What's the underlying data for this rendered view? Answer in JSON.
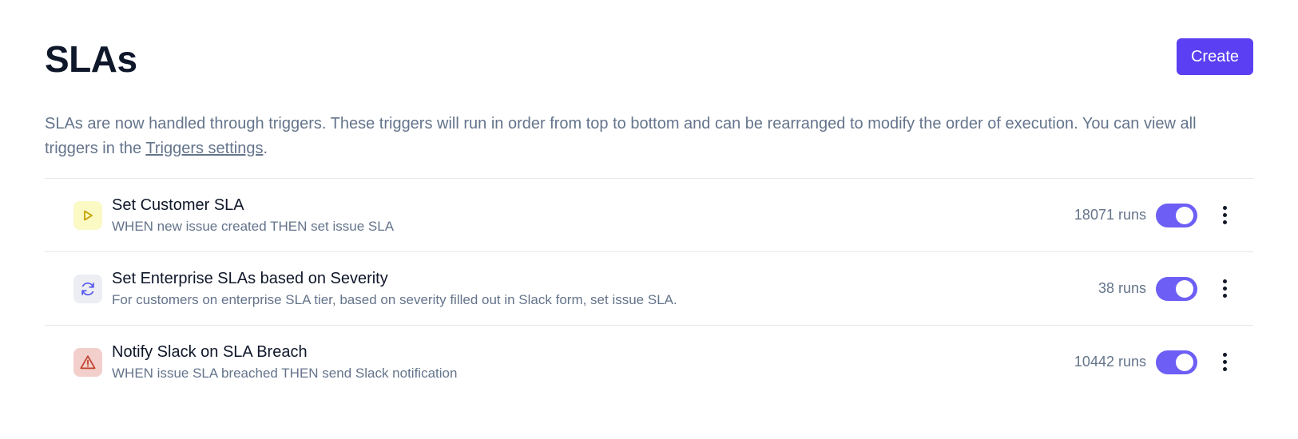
{
  "header": {
    "title": "SLAs",
    "create_label": "Create"
  },
  "description": {
    "text_before": "SLAs are now handled through triggers. These triggers will run in order from top to bottom and can be rearranged to modify the order of execution. You can view all triggers in the ",
    "link_text": "Triggers settings",
    "text_after": "."
  },
  "colors": {
    "accent": "#5b3ff2",
    "toggle_on": "#6d5ef5",
    "play_icon_bg": "#fbf9c4",
    "play_icon": "#c5a100",
    "sync_icon_bg": "#eceef4",
    "sync_icon": "#5b5cf0",
    "warning_icon_bg": "#f3cfcc",
    "warning_icon": "#c2412d"
  },
  "triggers": [
    {
      "icon": "play-icon",
      "title": "Set Customer SLA",
      "subtitle": "WHEN new issue created THEN set issue SLA",
      "runs": "18071 runs",
      "enabled": true
    },
    {
      "icon": "sync-icon",
      "title": "Set Enterprise SLAs based on Severity",
      "subtitle": "For customers on enterprise SLA tier, based on severity filled out in Slack form, set issue SLA.",
      "runs": "38 runs",
      "enabled": true
    },
    {
      "icon": "warning-icon",
      "title": "Notify Slack on SLA Breach",
      "subtitle": "WHEN issue SLA breached THEN send Slack notification",
      "runs": "10442 runs",
      "enabled": true
    }
  ]
}
